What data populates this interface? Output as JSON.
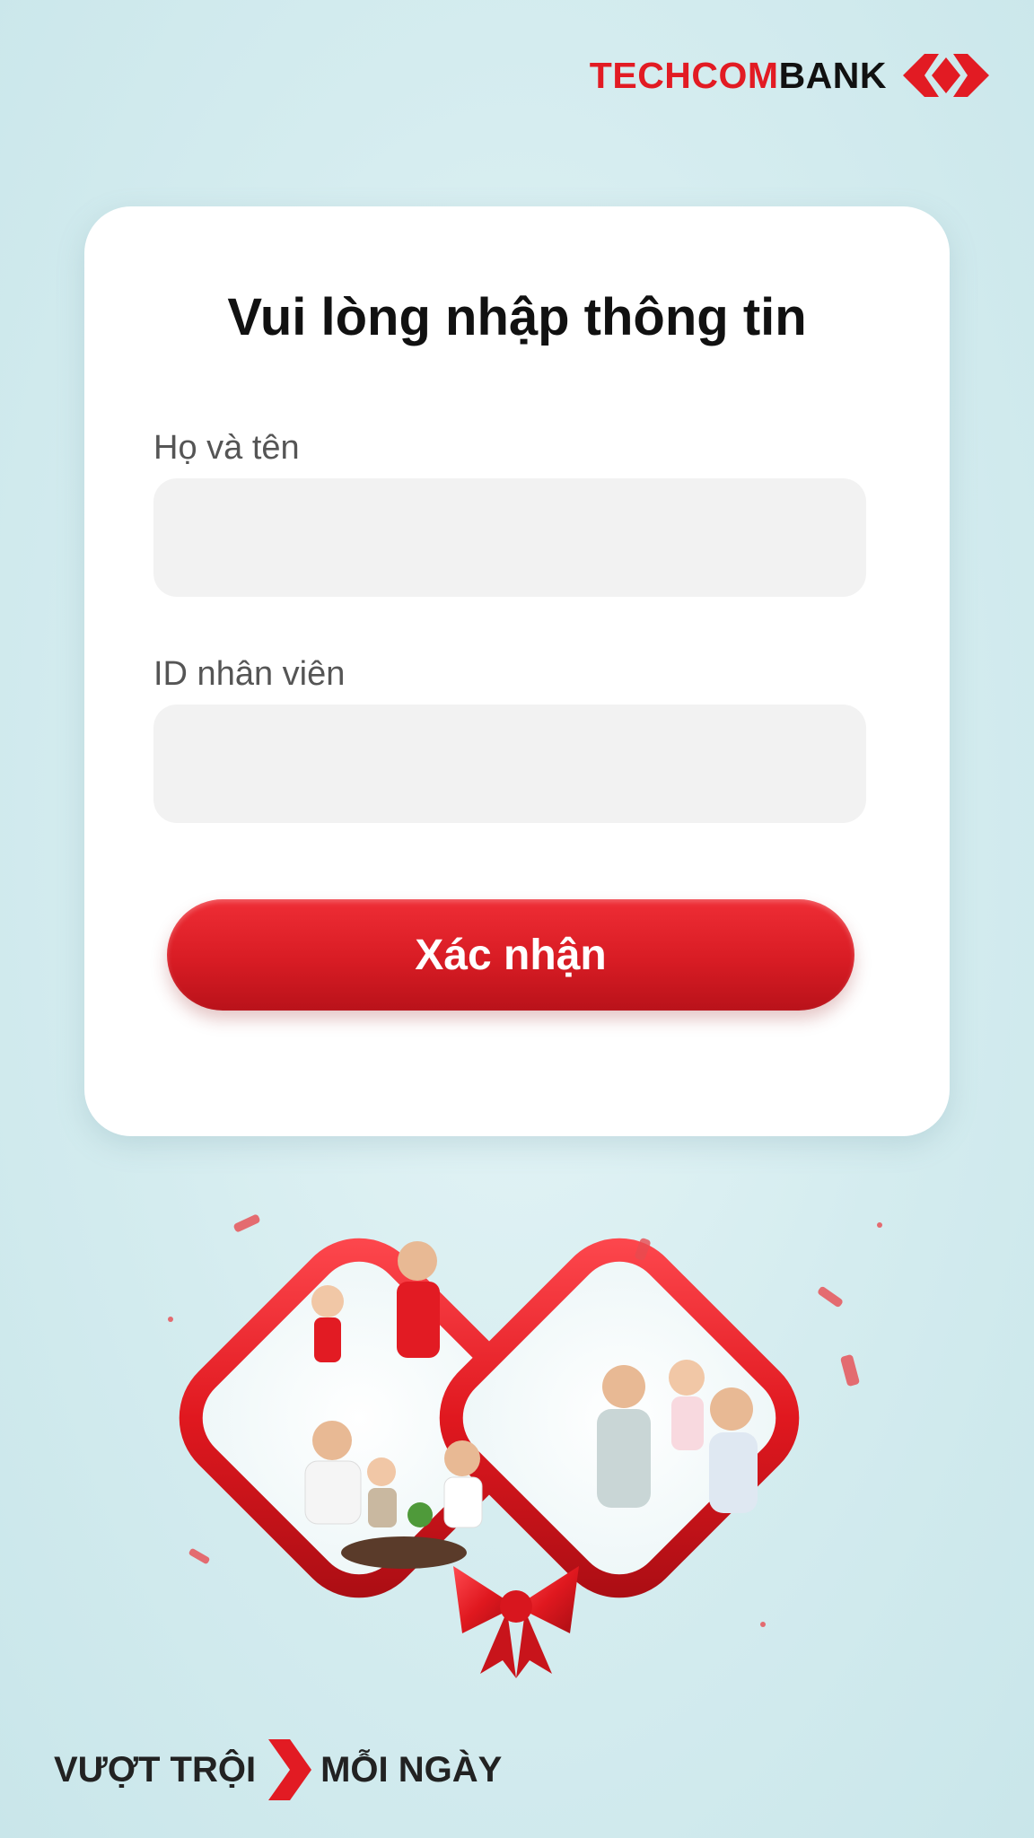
{
  "brand": {
    "name_part1": "TECHCOM",
    "name_part2": "BANK",
    "primary_color": "#e21b23",
    "logo_icon": "techcombank-diamond-icon"
  },
  "form": {
    "title": "Vui lòng nhập thông tin",
    "fields": [
      {
        "label": "Họ và tên",
        "value": "",
        "placeholder": ""
      },
      {
        "label": "ID nhân viên",
        "value": "",
        "placeholder": ""
      }
    ],
    "submit_label": "Xác nhận"
  },
  "illustration": {
    "icon": "family-ribbon-illustration"
  },
  "footer": {
    "slogan_left": "VƯỢT TRỘI",
    "slogan_right": "MỖI NGÀY",
    "slogan_icon": "chevron-brand-icon"
  }
}
